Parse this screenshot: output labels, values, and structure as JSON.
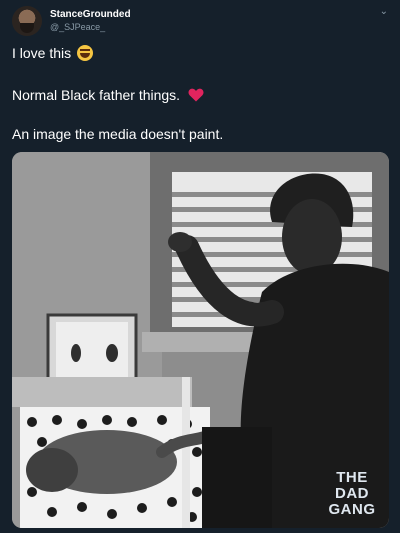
{
  "header": {
    "display_name": "StanceGrounded",
    "handle": "@_SJPeace_",
    "menu_icon": "chevron-down-icon"
  },
  "tweet": {
    "line1": "I love this",
    "line1_emoji": "face-with-tears-of-joy-icon",
    "line2": "Normal Black father things.",
    "line2_emoji": "red-heart-icon",
    "line3": "An image the media doesn't paint."
  },
  "media": {
    "watermark_line1": "THE",
    "watermark_line2": "DAD",
    "watermark_line3": "GANG"
  },
  "colors": {
    "background": "#15202b",
    "text": "#ffffff",
    "secondary_text": "#8899a6",
    "heart": "#e0245e"
  }
}
